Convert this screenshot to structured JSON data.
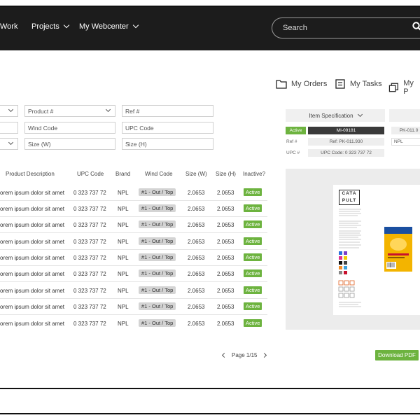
{
  "nav": {
    "items": [
      {
        "label": "Work",
        "dropdown": false
      },
      {
        "label": "Projects",
        "dropdown": true
      },
      {
        "label": "My Webcenter",
        "dropdown": true
      }
    ],
    "search_placeholder": "Search"
  },
  "quick_links": [
    {
      "label": "My Orders",
      "icon": "folder-icon"
    },
    {
      "label": "My Tasks",
      "icon": "task-list-icon"
    },
    {
      "label": "My P",
      "icon": "copy-icon"
    }
  ],
  "filters": {
    "col0_row1": "",
    "product": "Product #",
    "ref": "Ref #",
    "col0_row2": "",
    "wind_code": "Wind Code",
    "upc_code": "UPC Code",
    "col0_row3": "",
    "size_w": "Size (W)",
    "size_h": "Size (H)"
  },
  "table": {
    "headers": [
      "Product Description",
      "UPC Code",
      "Brand",
      "Wind Code",
      "Size (W)",
      "Size (H)",
      "Inactive?"
    ],
    "rows": [
      {
        "desc": "orem ipsum dolor sit amet",
        "upc": "0 323 737 72",
        "brand": "NPL",
        "wind": "#1 - Out / Top",
        "w": "2.0653",
        "h": "2.0653",
        "status": "Active"
      },
      {
        "desc": "orem ipsum dolor sit amet",
        "upc": "0 323 737 72",
        "brand": "NPL",
        "wind": "#1 - Out / Top",
        "w": "2.0653",
        "h": "2.0653",
        "status": "Active"
      },
      {
        "desc": "orem ipsum dolor sit amet",
        "upc": "0 323 737 72",
        "brand": "NPL",
        "wind": "#1 - Out / Top",
        "w": "2.0653",
        "h": "2.0653",
        "status": "Active"
      },
      {
        "desc": "orem ipsum dolor sit amet",
        "upc": "0 323 737 72",
        "brand": "NPL",
        "wind": "#1 - Out / Top",
        "w": "2.0653",
        "h": "2.0653",
        "status": "Active"
      },
      {
        "desc": "orem ipsum dolor sit amet",
        "upc": "0 323 737 72",
        "brand": "NPL",
        "wind": "#1 - Out / Top",
        "w": "2.0653",
        "h": "2.0653",
        "status": "Active"
      },
      {
        "desc": "orem ipsum dolor sit amet",
        "upc": "0 323 737 72",
        "brand": "NPL",
        "wind": "#1 - Out / Top",
        "w": "2.0653",
        "h": "2.0653",
        "status": "Active"
      },
      {
        "desc": "orem ipsum dolor sit amet",
        "upc": "0 323 737 72",
        "brand": "NPL",
        "wind": "#1 - Out / Top",
        "w": "2.0653",
        "h": "2.0653",
        "status": "Active"
      },
      {
        "desc": "orem ipsum dolor sit amet",
        "upc": "0 323 737 72",
        "brand": "NPL",
        "wind": "#1 - Out / Top",
        "w": "2.0653",
        "h": "2.0653",
        "status": "Active"
      },
      {
        "desc": "orem ipsum dolor sit amet",
        "upc": "0 323 737 72",
        "brand": "NPL",
        "wind": "#1 - Out / Top",
        "w": "2.0653",
        "h": "2.0653",
        "status": "Active"
      }
    ]
  },
  "pagination": {
    "label": "Page 1/15"
  },
  "spec": {
    "header": "Item Specification",
    "status": "Active",
    "item_id": "MI-09181",
    "ref_label": "Ref #",
    "ref_value": "Ref: PK-011.930",
    "upc_label": "UPC #",
    "upc_value": "UPC Code: 0 323 737 72",
    "col2_id": "PK-011.0",
    "col2_brand": "NPL"
  },
  "preview": {
    "logo_top": "CATA",
    "logo_bottom": "PULT"
  },
  "download_label": "Download PDF",
  "colors": {
    "nav_bg": "#1c1c1c",
    "active_green": "#6db33f",
    "badge_gray": "#d4d4d4"
  }
}
